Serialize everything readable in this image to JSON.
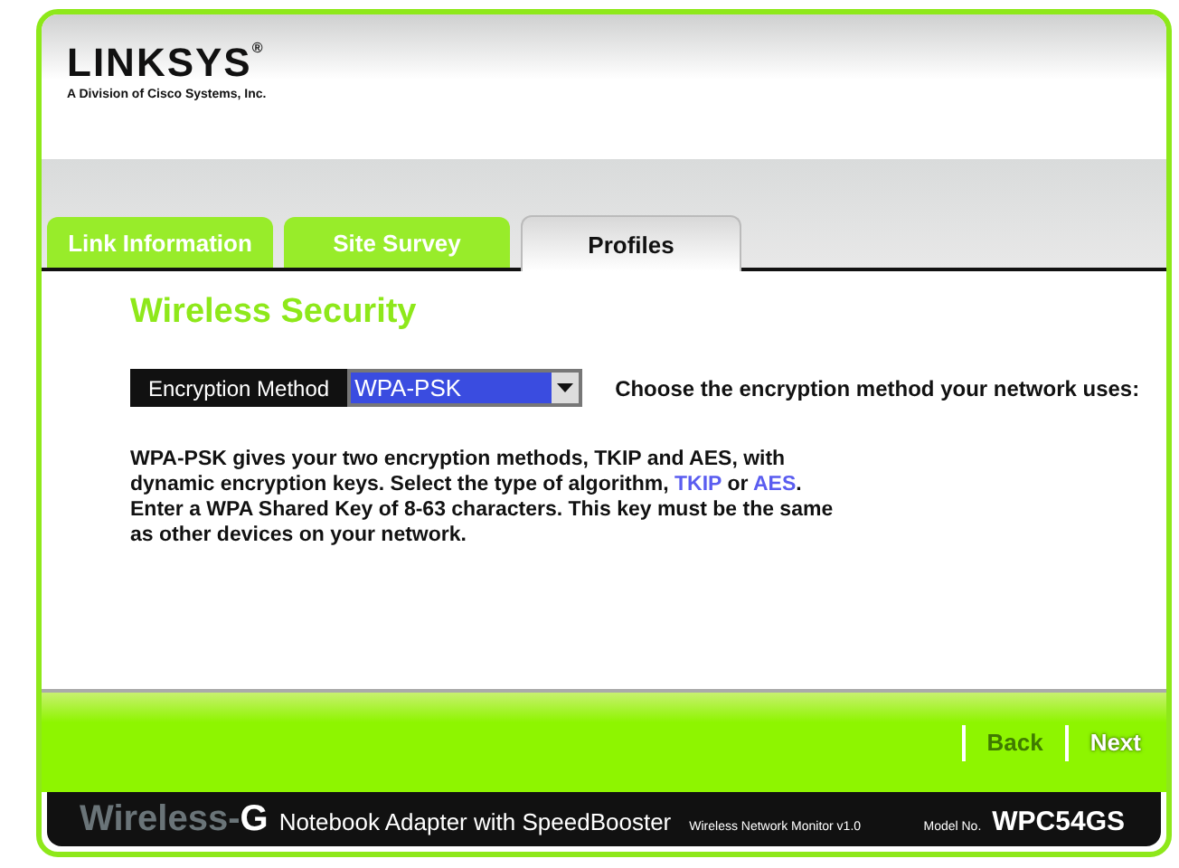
{
  "header": {
    "logo": "LINKSYS",
    "registered": "®",
    "tagline": "A Division of Cisco Systems, Inc."
  },
  "tabs": [
    {
      "label": "Link Information",
      "selected": false
    },
    {
      "label": "Site Survey",
      "selected": false
    },
    {
      "label": "Profiles",
      "selected": true
    }
  ],
  "section_title": "Wireless Security",
  "encryption": {
    "label": "Encryption Method",
    "value": "WPA-PSK",
    "hint": "Choose the encryption method your network uses:"
  },
  "description": [
    {
      "kind": "text",
      "text": "WPA-PSK gives your two encryption methods, TKIP and AES, with dynamic encryption keys. Select the type of algorithm, "
    },
    {
      "kind": "link",
      "text": "TKIP"
    },
    {
      "kind": "text",
      "text": " or "
    },
    {
      "kind": "link",
      "text": "AES"
    },
    {
      "kind": "text",
      "text": ". Enter a WPA Shared Key of 8-63 characters. This key must be the same as other devices on your network."
    }
  ],
  "nav_buttons": [
    {
      "label": "Back",
      "disabled": true
    },
    {
      "label": "Next",
      "disabled": false
    }
  ],
  "footer": {
    "product_prefix": "Wireless-",
    "product_letter": "G",
    "product_name": "Notebook Adapter with SpeedBooster",
    "app_name": "Wireless Network Monitor v1.0",
    "model_label": "Model No.",
    "model": "WPC54GS"
  }
}
